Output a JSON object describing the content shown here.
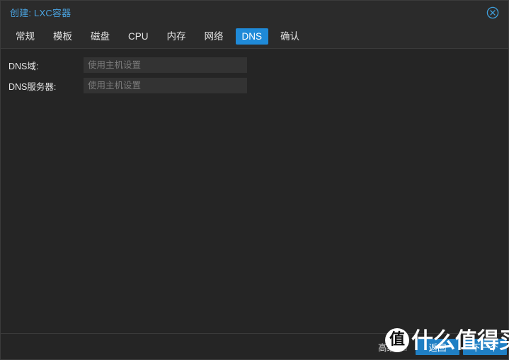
{
  "window": {
    "title": "创建: LXC容器",
    "close_icon": "close-circle-icon",
    "accent_color": "#1f8ad8",
    "title_color": "#4aa3e0",
    "background_color": "#252525"
  },
  "tabs": [
    {
      "label": "常规",
      "name": "tab-general",
      "active": false
    },
    {
      "label": "模板",
      "name": "tab-template",
      "active": false
    },
    {
      "label": "磁盘",
      "name": "tab-disk",
      "active": false
    },
    {
      "label": "CPU",
      "name": "tab-cpu",
      "active": false
    },
    {
      "label": "内存",
      "name": "tab-memory",
      "active": false
    },
    {
      "label": "网络",
      "name": "tab-network",
      "active": false
    },
    {
      "label": "DNS",
      "name": "tab-dns",
      "active": true
    },
    {
      "label": "确认",
      "name": "tab-confirm",
      "active": false
    }
  ],
  "form": {
    "fields": [
      {
        "label": "DNS域:",
        "value": "",
        "placeholder": "使用主机设置"
      },
      {
        "label": "DNS服务器:",
        "value": "",
        "placeholder": "使用主机设置"
      }
    ]
  },
  "footer": {
    "advanced_label": "高级",
    "advanced_checked": false,
    "back_label": "返回",
    "next_label": "下一个"
  },
  "watermark": {
    "badge": "值",
    "text": "什么值得买"
  }
}
